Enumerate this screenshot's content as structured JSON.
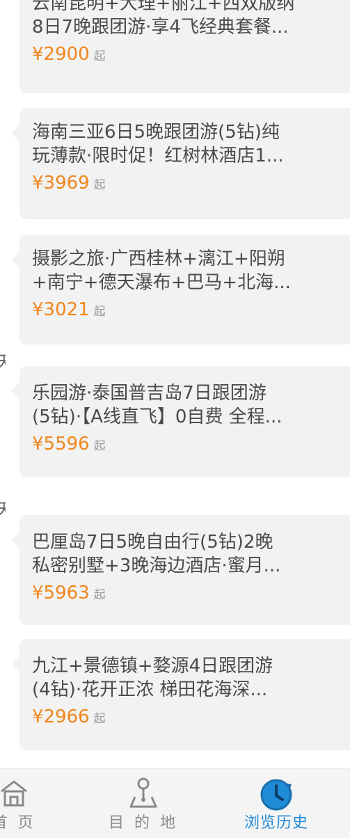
{
  "history": {
    "items": [
      {
        "title_line1": "云南昆明+大理+丽江+西双版纳",
        "title_line2": "8日7晚跟团游·享4飞经典套餐...",
        "price": "¥2900",
        "suffix": "起"
      },
      {
        "title_line1": "海南三亚6日5晚跟团游(5钻)纯",
        "title_line2": "玩薄款·限时促！红树林酒店1...",
        "price": "¥3969",
        "suffix": "起"
      },
      {
        "title_line1": "摄影之旅·广西桂林+漓江+阳朔",
        "title_line2": "+南宁+德天瀑布+巴马+北海...",
        "price": "¥3021",
        "suffix": "起"
      },
      {
        "title_line1": "乐园游·泰国普吉岛7日跟团游",
        "title_line2": "(5钻)·【A线直飞】0自费 全程...",
        "price": "¥5596",
        "suffix": "起"
      },
      {
        "title_line1": "巴厘岛7日5晚自由行(5钻)2晚",
        "title_line2": "私密别墅+3晚海边酒店·蜜月...",
        "price": "¥5963",
        "suffix": "起"
      },
      {
        "title_line1": "九江+景德镇+婺源4日跟团游",
        "title_line2": "(4钻)·花开正浓 梯田花海深...",
        "price": "¥2966",
        "suffix": "起"
      }
    ],
    "day_marks": [
      "天",
      "天"
    ]
  },
  "tabbar": {
    "home": "首 页",
    "destination": "目 的 地",
    "history": "浏览历史"
  },
  "colors": {
    "accent": "#1e8bd6",
    "price": "#f0861c",
    "card_bg": "#f2f2f2"
  },
  "icons": {
    "home": "home-icon",
    "destination": "map-pin-icon",
    "history": "clock-history-icon"
  }
}
